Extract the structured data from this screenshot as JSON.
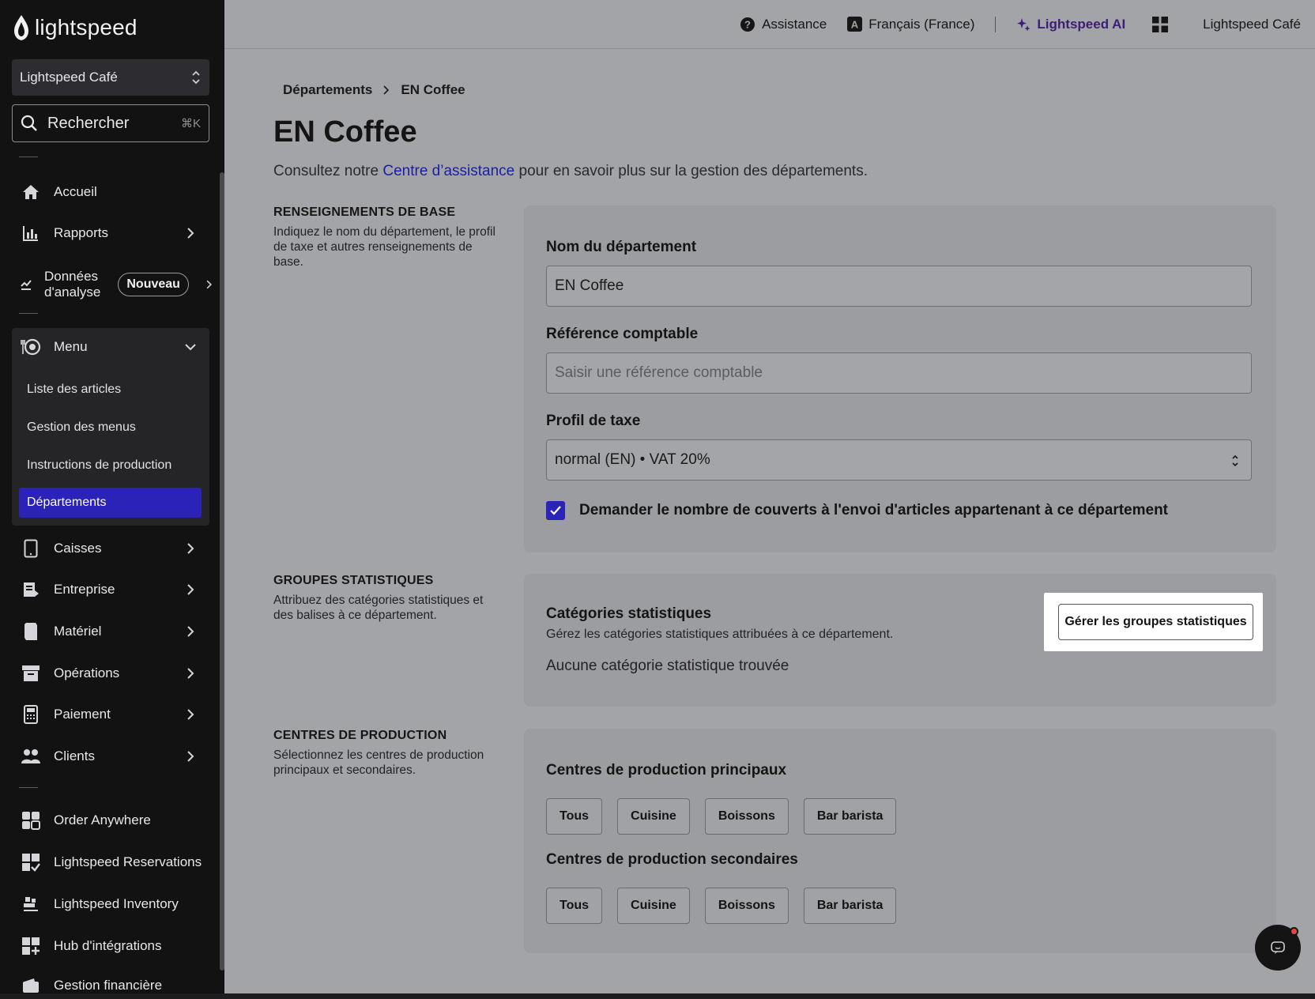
{
  "sidebar": {
    "brand": "lightspeed",
    "location": "Lightspeed Café",
    "search": {
      "label": "Rechercher",
      "shortcut": "⌘K"
    },
    "nav": {
      "home": "Accueil",
      "reports": "Rapports",
      "analytics_line1": "Données",
      "analytics_line2": "d'analyse",
      "analytics_badge": "Nouveau",
      "menu": "Menu",
      "menu_items": [
        "Liste des articles",
        "Gestion des menus",
        "Instructions de production",
        "Départements"
      ],
      "registers": "Caisses",
      "business": "Entreprise",
      "hardware": "Matériel",
      "operations": "Opérations",
      "payment": "Paiement",
      "customers": "Clients",
      "order_anywhere": "Order Anywhere",
      "reservations": "Lightspeed Reservations",
      "inventory": "Lightspeed Inventory",
      "integrations": "Hub d'intégrations",
      "finance": "Gestion financière"
    }
  },
  "topbar": {
    "help": "Assistance",
    "language": "Français (France)",
    "ai": "Lightspeed AI",
    "account": "Lightspeed Café"
  },
  "main": {
    "breadcrumb": {
      "parent": "Départements",
      "current": "EN Coffee"
    },
    "title": "EN Coffee",
    "intro_before": "Consultez notre ",
    "intro_link": "Centre d’assistance",
    "intro_after": " pour en savoir plus sur la gestion des départements.",
    "basic": {
      "title": "RENSEIGNEMENTS DE BASE",
      "desc": "Indiquez le nom du département, le profil de taxe et autres renseignements de base.",
      "name_label": "Nom du département",
      "name_value": "EN Coffee",
      "ref_label": "Référence comptable",
      "ref_placeholder": "Saisir une référence comptable",
      "tax_label": "Profil de taxe",
      "tax_value": "normal (EN) • VAT 20%",
      "covers_label": "Demander le nombre de couverts à l'envoi d'articles appartenant à ce département"
    },
    "stats": {
      "title": "GROUPES STATISTIQUES",
      "desc": "Attribuez des catégories statistiques et des balises à ce département.",
      "card_title": "Catégories statistiques",
      "card_desc": "Gérez les catégories statistiques attribuées à ce département.",
      "empty": "Aucune catégorie statistique trouvée",
      "manage_button": "Gérer les groupes statistiques"
    },
    "production": {
      "title": "CENTRES DE PRODUCTION",
      "desc": "Sélectionnez les centres de production principaux et secondaires.",
      "primary_title": "Centres de production principaux",
      "primary_chips": [
        "Tous",
        "Cuisine",
        "Boissons",
        "Bar barista"
      ],
      "secondary_title": "Centres de production secondaires",
      "secondary_chips": [
        "Tous",
        "Cuisine",
        "Boissons",
        "Bar barista"
      ]
    }
  },
  "colors": {
    "accent": "#2b22b8",
    "sidebar_bg": "#121212",
    "ai": "#3c1d78",
    "overlay_bg": "#a3a4a8"
  }
}
